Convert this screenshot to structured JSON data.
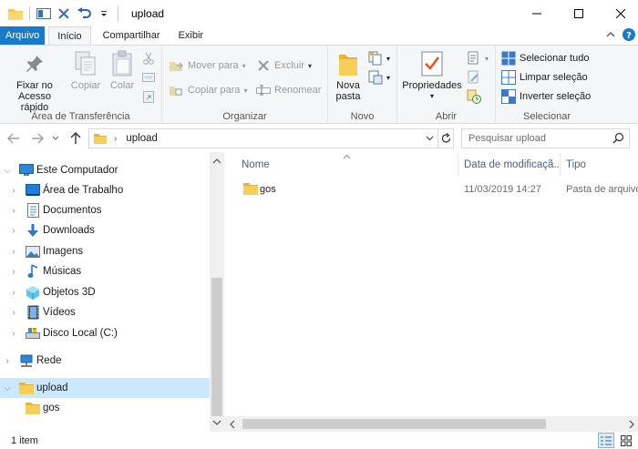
{
  "window": {
    "title": "upload",
    "colors": {
      "accent": "#1979ca",
      "ribbon_bg": "#f5f6f7",
      "selected": "#cce8ff",
      "folder": "#f3c84d"
    }
  },
  "quick_access": {
    "icons": [
      "folder-icon",
      "properties-icon",
      "delete-icon",
      "undo-icon",
      "customize-dropdown-icon"
    ]
  },
  "ribbon_tabs": [
    {
      "label": "Arquivo"
    },
    {
      "label": "Início"
    },
    {
      "label": "Compartilhar"
    },
    {
      "label": "Exibir"
    }
  ],
  "ribbon": {
    "clipboard": {
      "label": "Área de Transferência",
      "pin_line1": "Fixar no",
      "pin_line2": "Acesso rápido",
      "copy": "Copiar",
      "paste": "Colar"
    },
    "organize": {
      "label": "Organizar",
      "move_to": "Mover para",
      "copy_to": "Copiar para",
      "delete": "Excluir",
      "rename": "Renomear"
    },
    "new": {
      "label": "Novo",
      "new_folder_line1": "Nova",
      "new_folder_line2": "pasta"
    },
    "open": {
      "label": "Abrir",
      "properties": "Propriedades"
    },
    "select": {
      "label": "Selecionar",
      "select_all": "Selecionar tudo",
      "select_none": "Limpar seleção",
      "invert": "Inverter seleção"
    }
  },
  "address": {
    "path": "upload",
    "search_placeholder": "Pesquisar upload"
  },
  "nav_tree": [
    {
      "label": "Este Computador",
      "icon": "computer-icon"
    },
    {
      "label": "Área de Trabalho",
      "icon": "desktop-icon"
    },
    {
      "label": "Documentos",
      "icon": "documents-icon"
    },
    {
      "label": "Downloads",
      "icon": "downloads-icon"
    },
    {
      "label": "Imagens",
      "icon": "pictures-icon"
    },
    {
      "label": "Músicas",
      "icon": "music-icon"
    },
    {
      "label": "Objetos 3D",
      "icon": "3d-objects-icon"
    },
    {
      "label": "Vídeos",
      "icon": "videos-icon"
    },
    {
      "label": "Disco Local (C:)",
      "icon": "drive-icon"
    },
    {
      "label": "Rede",
      "icon": "network-icon"
    },
    {
      "label": "upload",
      "icon": "folder-icon"
    },
    {
      "label": "gos",
      "icon": "folder-icon"
    }
  ],
  "columns": {
    "name": "Nome",
    "date": "Data de modificaçã...",
    "type": "Tipo"
  },
  "files": [
    {
      "name": "gos",
      "date": "11/03/2019 14:27",
      "type": "Pasta de arquivos"
    }
  ],
  "status": {
    "count": "1 item"
  }
}
